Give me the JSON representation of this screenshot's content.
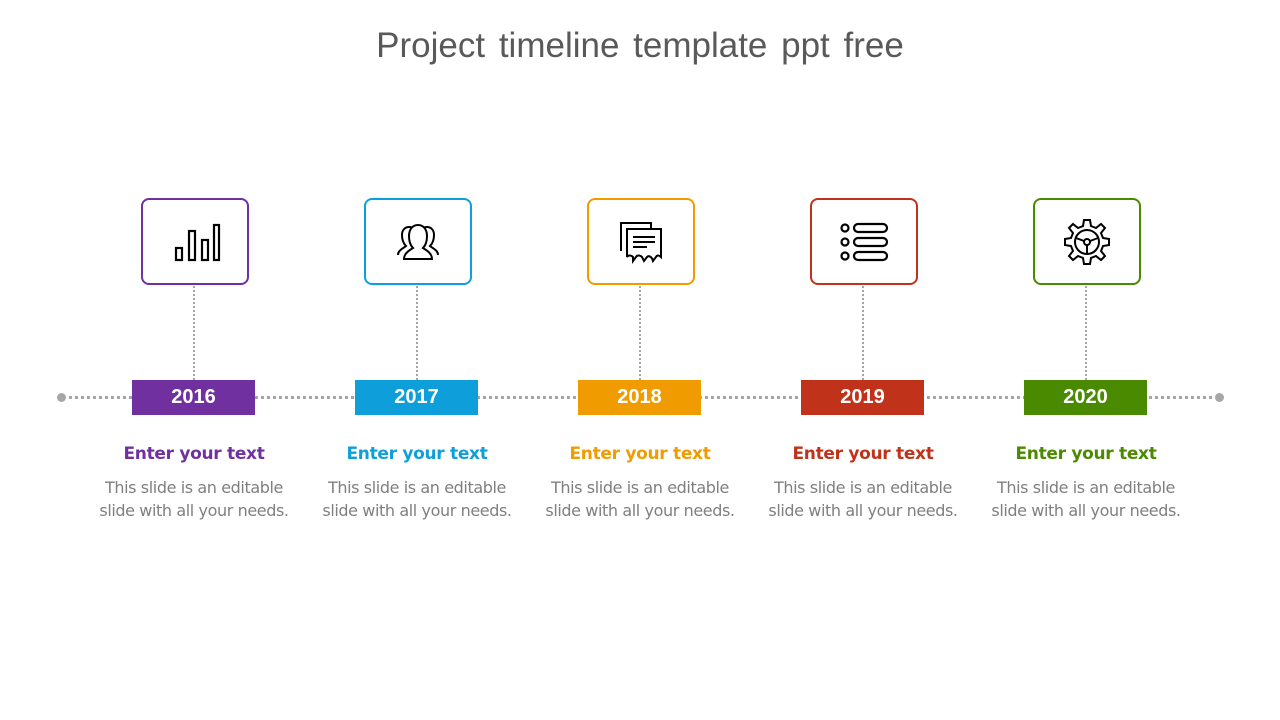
{
  "title": "Project timeline template ppt free",
  "milestones": [
    {
      "year": "2016",
      "heading": "Enter your text",
      "desc1": "This slide is an editable",
      "desc2": "slide with all your needs.",
      "color": "#7030a0",
      "icon": "bar-chart-icon"
    },
    {
      "year": "2017",
      "heading": "Enter your text",
      "desc1": "This slide is an editable",
      "desc2": "slide with all your needs.",
      "color": "#0e9fda",
      "icon": "team-icon"
    },
    {
      "year": "2018",
      "heading": "Enter your text",
      "desc1": "This slide is an editable",
      "desc2": "slide with all your needs.",
      "color": "#f09c00",
      "icon": "messages-icon"
    },
    {
      "year": "2019",
      "heading": "Enter your text",
      "desc1": "This slide is an editable",
      "desc2": "slide with all your needs.",
      "color": "#c0321a",
      "icon": "list-icon"
    },
    {
      "year": "2020",
      "heading": "Enter your text",
      "desc1": "This slide is an editable",
      "desc2": "slide with all your needs.",
      "color": "#4a8a00",
      "icon": "gear-wheel-icon"
    }
  ]
}
